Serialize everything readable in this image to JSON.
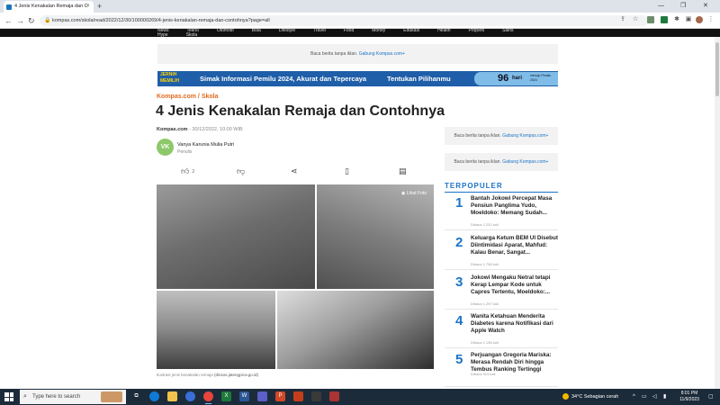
{
  "browser": {
    "tab_title": "4 Jenis Kenakalan Remaja dan C",
    "tab_close": "×",
    "new_tab": "+",
    "url": "kompas.com/skola/read/2022/12/30/100000269/4-jenis-kenakalan-remaja-dan-contohnya?page=all",
    "window_controls": [
      "—",
      "❐",
      "✕"
    ]
  },
  "site_nav": [
    "News",
    "Tekno",
    "Otomotif",
    "Bola",
    "Lifestyle",
    "Travel",
    "Food",
    "Money",
    "Edukasi",
    "Health",
    "Properti",
    "Sains",
    "Hype",
    "Skola"
  ],
  "ads": {
    "top_text": "Baca berita tanpa iklan.",
    "top_link": "Gabung Kompas.com+",
    "side1_text": "Baca berita tanpa iklan.",
    "side1_link": "Gabung Kompas.com+",
    "side2_text": "Baca berita tanpa iklan.",
    "side2_link": "Gabung Kompas.com+"
  },
  "banner": {
    "logo": "JERNIH MEMILIH",
    "text": "Simak Informasi Pemilu 2024, Akurat dan Tepercaya",
    "cta": "Tentukan Pilihanmu",
    "days_number": "96",
    "days_unit": "hari",
    "days_sub": "menuju Pemilu 2024"
  },
  "article": {
    "breadcrumb_site": "Kompas.com",
    "breadcrumb_sep": " / ",
    "breadcrumb_section": "Skola",
    "title": "4 Jenis Kenakalan Remaja dan Contohnya",
    "source": "Kompas.com",
    "date": " - 30/12/2022, 10:00 WIB",
    "author_initials": "VK",
    "author_name": "Vanya Karunia Mulia Putri",
    "author_role": "Penulis",
    "like_count": "2",
    "photo_button": "Lihat Foto",
    "caption_text": "Ilustrasi jenis kenakalan remaja",
    "caption_source": "(dinsos.jatengprov.go.id)"
  },
  "terpopuler": {
    "heading": "TERPOPULER",
    "items": [
      {
        "num": "1",
        "title": "Bantah Jokowi Percepat Masa Pensiun Panglima Yudo, Moeldoko: Memang Sudah...",
        "views": "Dibaca 2.232 kali"
      },
      {
        "num": "2",
        "title": "Keluarga Ketum BEM UI Disebut Diintimidasi Aparat, Mahfud: Kalau Benar, Sangat...",
        "views": "Dibaca 1.758 kali"
      },
      {
        "num": "3",
        "title": "Jokowi Mengaku Netral tetapi Kerap Lempar Kode untuk Capres Tertentu, Moeldoko:...",
        "views": "Dibaca 1.297 kali"
      },
      {
        "num": "4",
        "title": "Wanita Ketahuan Menderita Diabetes karena Notifikasi dari Apple Watch",
        "views": "Dibaca 1.138 kali"
      },
      {
        "num": "5",
        "title": "Perjuangan Gregoria Mariska: Merasa Rendah Diri hingga Tembus Ranking Tertinggi",
        "views": "Dibaca 913 kali"
      }
    ]
  },
  "taskbar": {
    "search_placeholder": "Type here to search",
    "weather": "34°C  Sebagian cerah",
    "time": "8:01 PM",
    "date": "11/9/2023"
  }
}
